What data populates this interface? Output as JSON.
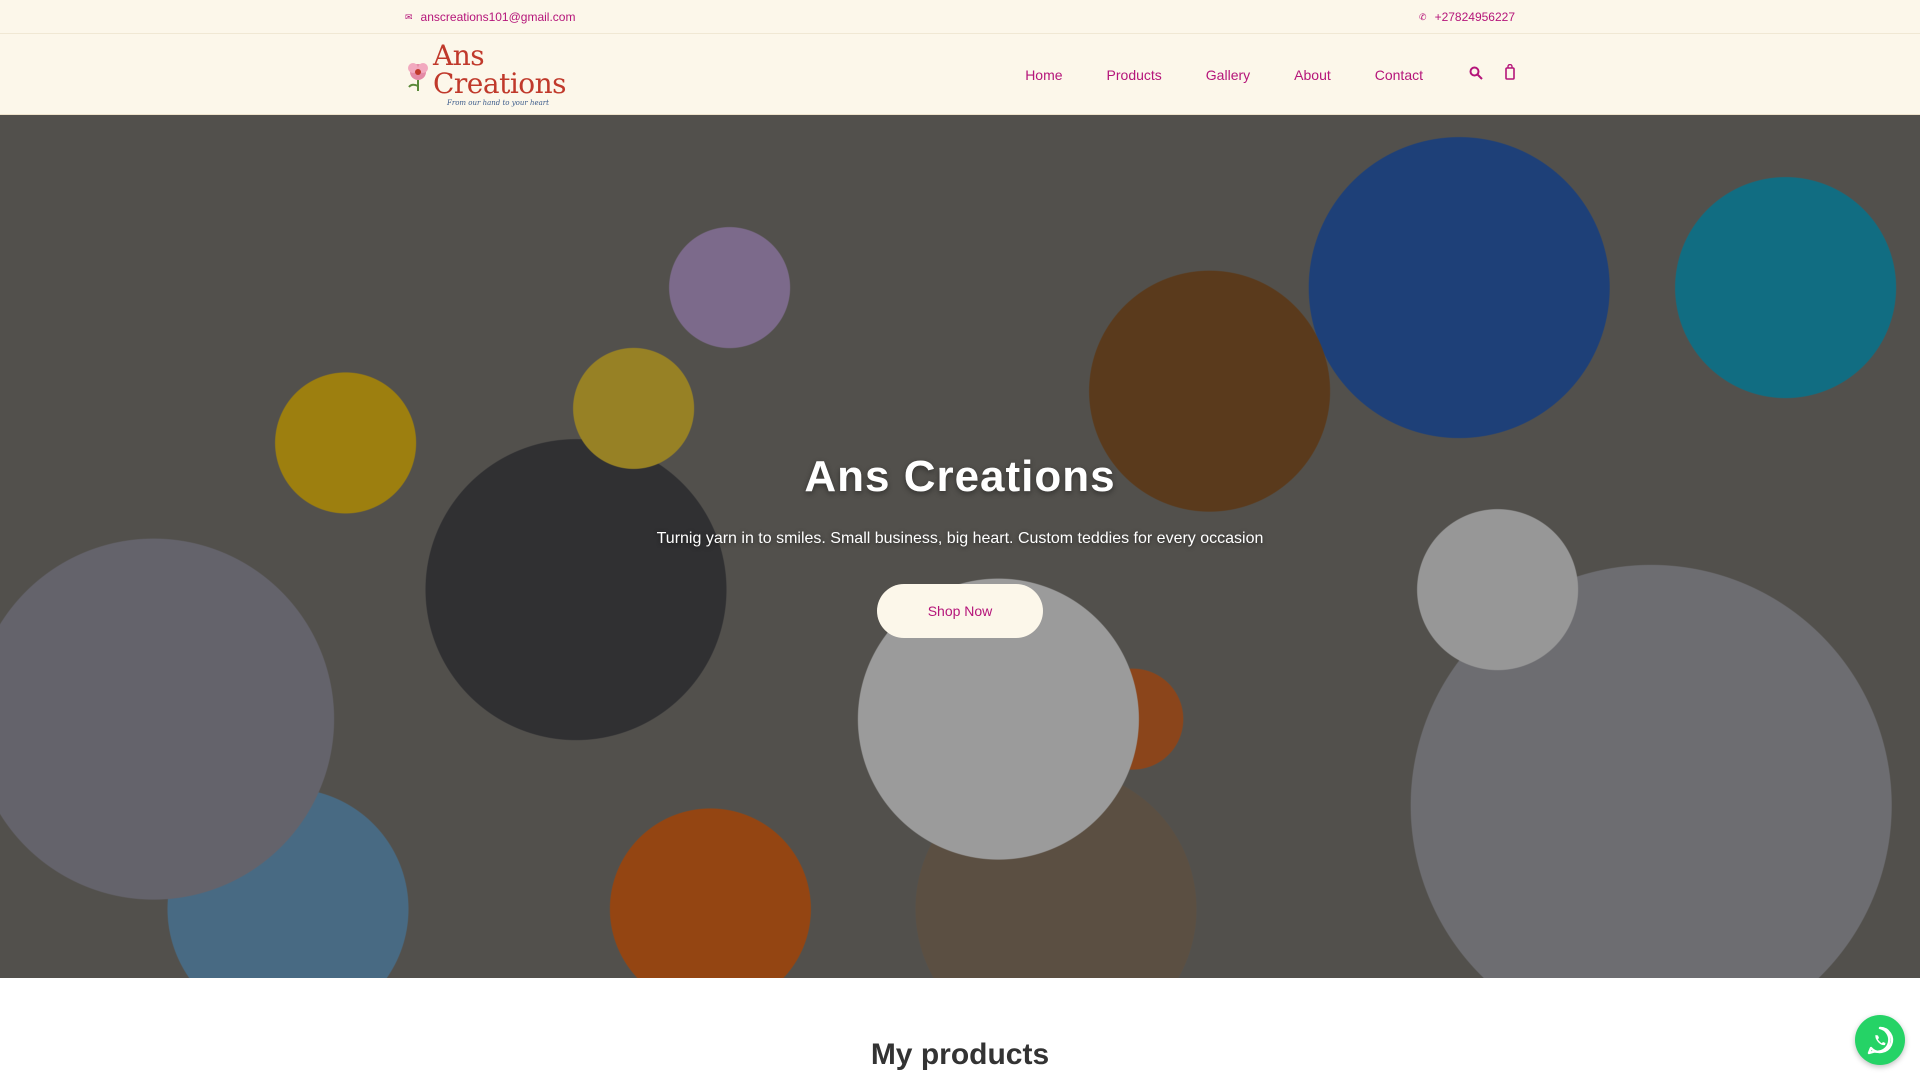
{
  "topbar": {
    "email": "anscreations101@gmail.com",
    "email_icon": "envelope-icon",
    "phone": "+27824956227",
    "phone_icon": "phone-icon"
  },
  "brand": {
    "name": "Ans Creations",
    "tagline": "From our hand to your heart",
    "logo_icon": "flower-icon"
  },
  "nav": {
    "items": [
      {
        "label": "Home"
      },
      {
        "label": "Products"
      },
      {
        "label": "Gallery"
      },
      {
        "label": "About"
      },
      {
        "label": "Contact"
      }
    ],
    "search_icon": "search-icon",
    "cart_icon": "cart-icon"
  },
  "hero": {
    "title": "Ans Creations",
    "subtitle": "Turnig yarn in to smiles. Small business, big heart. Custom teddies for every occasion",
    "cta_label": "Shop Now"
  },
  "sections": {
    "products_title": "My products"
  },
  "floating": {
    "whatsapp_icon": "whatsapp-icon"
  },
  "colors": {
    "accent": "#b5157a",
    "header_bg": "#fcf7ea",
    "whatsapp": "#25d366"
  }
}
